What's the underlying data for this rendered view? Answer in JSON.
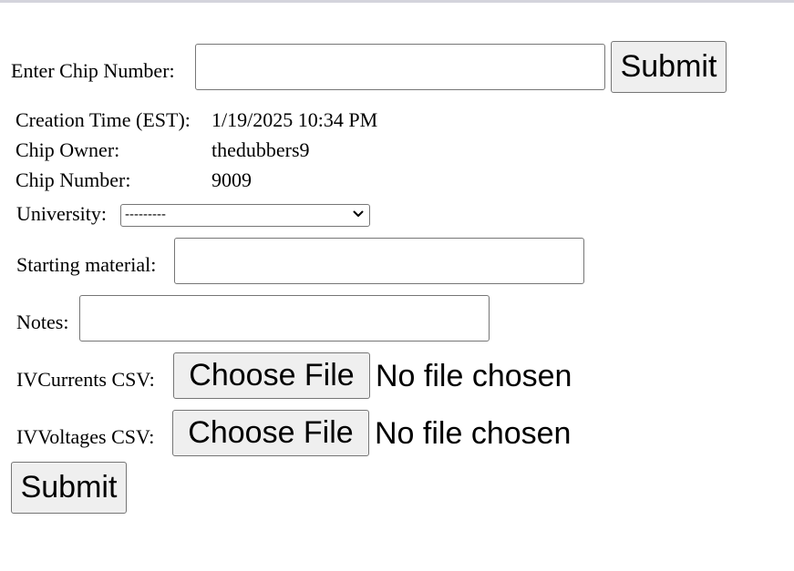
{
  "lookup": {
    "label": "Enter Chip Number:",
    "input_value": "",
    "submit_label": "Submit"
  },
  "info": {
    "creation_label": "Creation Time (EST):",
    "creation_value": "1/19/2025 10:34 PM",
    "owner_label": "Chip Owner:",
    "owner_value": "thedubbers9",
    "number_label": "Chip Number:",
    "number_value": "9009"
  },
  "form": {
    "university_label": "University:",
    "university_selected": "---------",
    "starting_material_label": "Starting material:",
    "starting_material_value": "",
    "notes_label": "Notes:",
    "notes_value": "",
    "iv_currents_label": "IVCurrents CSV:",
    "iv_voltages_label": "IVVoltages CSV:",
    "choose_file_label": "Choose File",
    "no_file_text": "No file chosen",
    "submit_label": "Submit"
  },
  "icons": {
    "select_arrow": "chevron-down-icon"
  }
}
